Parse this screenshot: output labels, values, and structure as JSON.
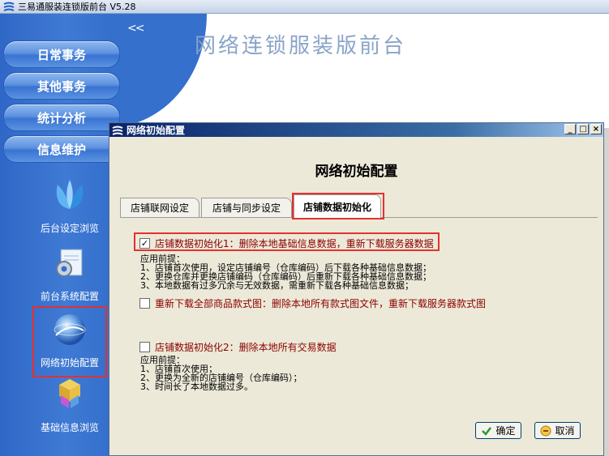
{
  "app": {
    "title": "三易通服装连锁版前台  V5.28",
    "main_title": "网络连锁服装版前台",
    "collapse_glyph": "<<"
  },
  "sidebar": {
    "nav_buttons": [
      {
        "label": "日常事务"
      },
      {
        "label": "其他事务"
      },
      {
        "label": "统计分析"
      },
      {
        "label": "信息维护"
      }
    ],
    "items": [
      {
        "label": "后台设定浏览",
        "icon": "butterfly-icon"
      },
      {
        "label": "前台系统配置",
        "icon": "gear-document-icon"
      },
      {
        "label": "网络初始配置",
        "icon": "globe-icon",
        "selected": true
      },
      {
        "label": "基础信息浏览",
        "icon": "cubes-icon"
      }
    ]
  },
  "dialog": {
    "title": "网络初始配置",
    "heading": "网络初始配置",
    "window_buttons": {
      "minimize": "_",
      "maximize": "□",
      "close": "×"
    },
    "tabs": [
      {
        "label": "店铺联网设定",
        "active": false
      },
      {
        "label": "店铺与同步设定",
        "active": false
      },
      {
        "label": "店铺数据初始化",
        "active": true
      }
    ],
    "options": [
      {
        "label": "店铺数据初始化1：删除本地基础信息数据，重新下载服务器数据",
        "checked": true
      },
      {
        "label": "重新下载全部商品款式图：删除本地所有款式图文件，重新下载服务器款式图",
        "checked": false
      },
      {
        "label": "店铺数据初始化2：删除本地所有交易数据",
        "checked": false
      }
    ],
    "note1": {
      "title": "应用前提：",
      "lines": [
        "1、店铺首次使用，设定店铺编号（仓库编码）后下载各种基础信息数据；",
        "2、更换仓库并更换店铺编码（仓库编码）后重新下载各种基础信息数据；",
        "3、本地数据有过多冗余与无效数据，需重新下载各种基础信息数据；"
      ]
    },
    "note2": {
      "title": "应用前提：",
      "lines": [
        "1、店铺首次使用；",
        "2、更换为全新的店铺编号（仓库编码）；",
        "3、时间长了本地数据过多。"
      ]
    },
    "ok_button": "确定",
    "cancel_button": "取消"
  },
  "colors": {
    "sidebar_blue": "#3470cc",
    "highlight_red": "#e53030",
    "option_text": "#8b0000",
    "dialog_bg": "#ece9d8"
  }
}
